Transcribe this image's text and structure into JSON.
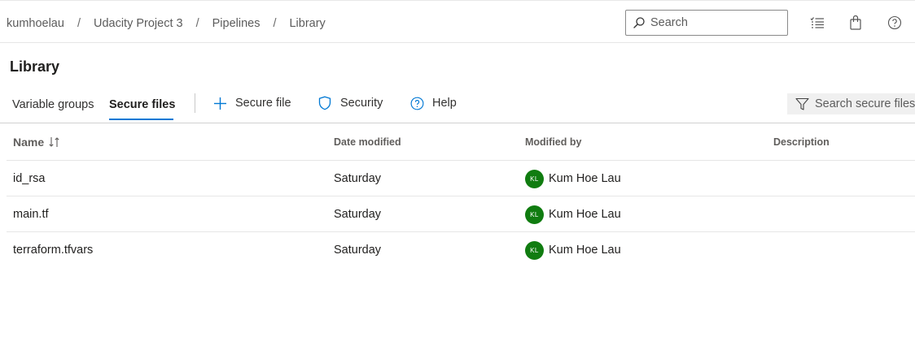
{
  "breadcrumb": {
    "items": [
      "kumhoelau",
      "Udacity Project 3",
      "Pipelines",
      "Library"
    ],
    "separator": "/"
  },
  "header": {
    "search_placeholder": "Search",
    "icons": [
      "search-icon",
      "task-list-icon",
      "shopping-bag-icon",
      "help-circle-icon"
    ]
  },
  "page": {
    "title": "Library"
  },
  "tabs": [
    {
      "label": "Variable groups",
      "active": false
    },
    {
      "label": "Secure files",
      "active": true
    }
  ],
  "commands": [
    {
      "label": "Secure file",
      "icon": "plus-icon"
    },
    {
      "label": "Security",
      "icon": "shield-icon"
    },
    {
      "label": "Help",
      "icon": "help-circle-icon"
    }
  ],
  "filter": {
    "placeholder": "Search secure files"
  },
  "table": {
    "columns": {
      "name": "Name",
      "date": "Date modified",
      "modified_by": "Modified by",
      "description": "Description"
    },
    "rows": [
      {
        "name": "id_rsa",
        "date": "Saturday",
        "initials": "KL",
        "modified_by": "Kum Hoe Lau",
        "description": ""
      },
      {
        "name": "main.tf",
        "date": "Saturday",
        "initials": "KL",
        "modified_by": "Kum Hoe Lau",
        "description": ""
      },
      {
        "name": "terraform.tfvars",
        "date": "Saturday",
        "initials": "KL",
        "modified_by": "Kum Hoe Lau",
        "description": ""
      }
    ]
  },
  "colors": {
    "accent": "#0078d4",
    "avatar": "#107c10",
    "filter_bg": "#f0f0f0"
  }
}
